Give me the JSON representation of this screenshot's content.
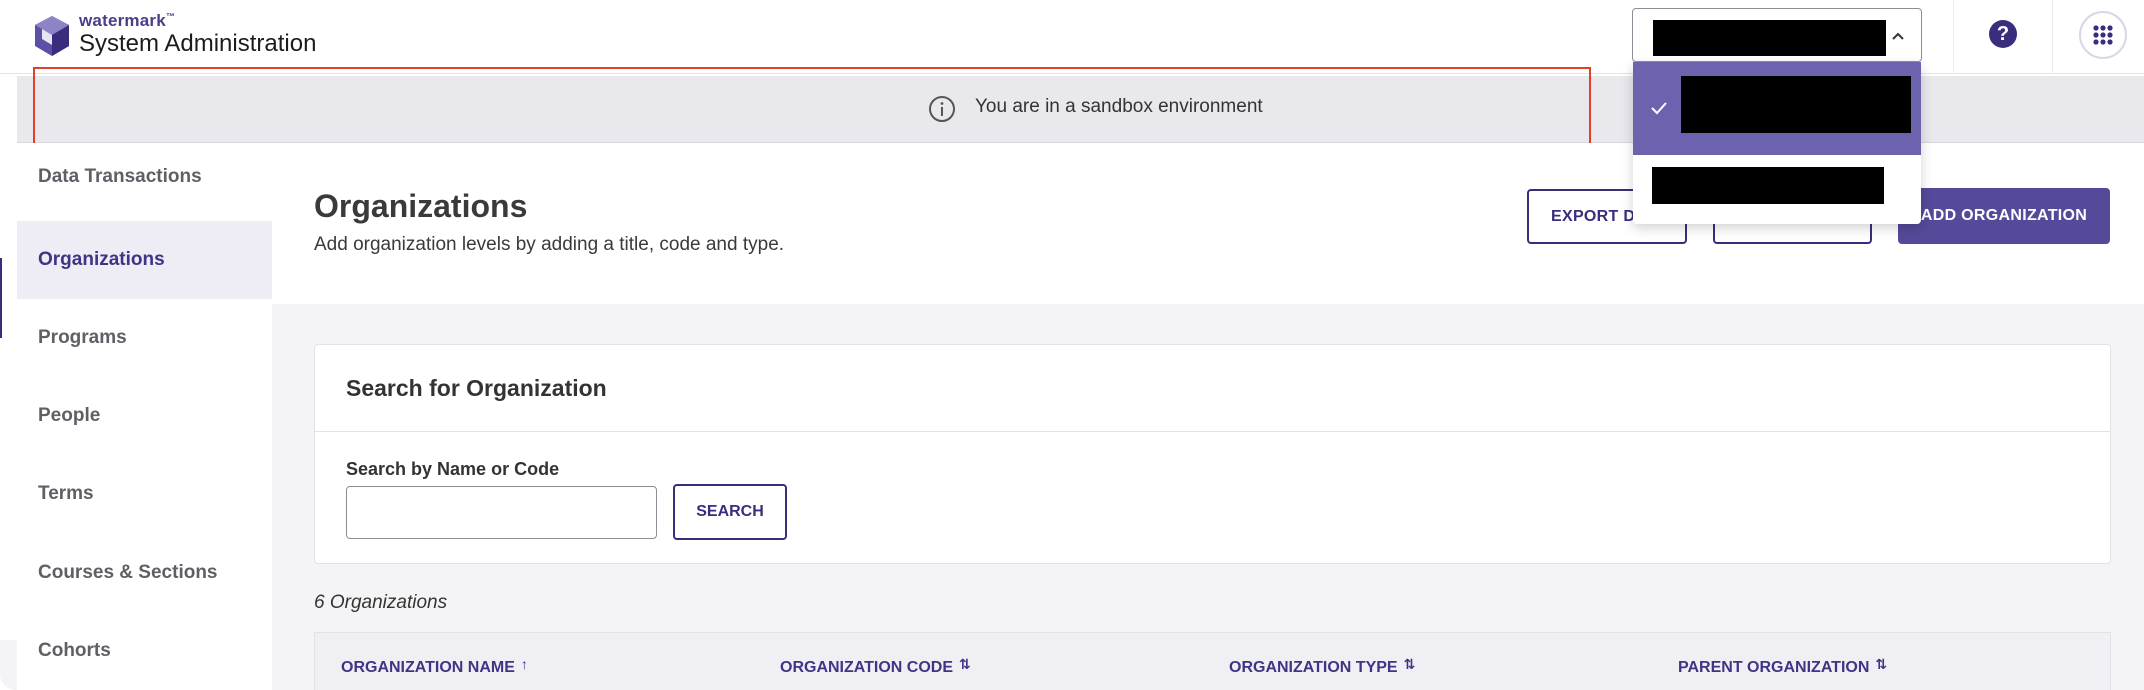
{
  "header": {
    "brand_small": "watermark",
    "brand_tm": "™",
    "app_title": "System Administration",
    "help_label": "?",
    "colors": {
      "brand": "#3a2d7e",
      "brand_light": "#544a9a",
      "highlight": "#e3402c"
    },
    "icons": {
      "logo": "watermark-logo-icon",
      "help": "help-icon",
      "apps": "apps-grid-icon",
      "select_chevron": "chevron-up-icon"
    }
  },
  "banner": {
    "text": "You are in a sandbox environment",
    "icon": "info-icon"
  },
  "sidebar": {
    "items": [
      {
        "label": "Data Transactions",
        "active": false
      },
      {
        "label": "Organizations",
        "active": true
      },
      {
        "label": "Programs",
        "active": false
      },
      {
        "label": "People",
        "active": false
      },
      {
        "label": "Terms",
        "active": false
      },
      {
        "label": "Courses & Sections",
        "active": false
      },
      {
        "label": "Cohorts",
        "active": false
      }
    ]
  },
  "page": {
    "title": "Organizations",
    "subtitle": "Add organization levels by adding a title, code and type.",
    "buttons": {
      "export_label": "EXPORT DATA",
      "second_label": "",
      "add_label": "ADD ORGANIZATION"
    }
  },
  "search_card": {
    "title": "Search for Organization",
    "field_label": "Search by Name or Code",
    "input_value": "",
    "search_label": "SEARCH"
  },
  "results": {
    "count_text": "6 Organizations",
    "columns": [
      {
        "label": "ORGANIZATION NAME",
        "sort_icon": "↑"
      },
      {
        "label": "ORGANIZATION CODE",
        "sort_icon": "⇅"
      },
      {
        "label": "ORGANIZATION TYPE",
        "sort_icon": "⇅"
      },
      {
        "label": "PARENT ORGANIZATION",
        "sort_icon": "⇅"
      }
    ]
  },
  "environment_dropdown": {
    "selected_value": "[redacted]",
    "options": [
      {
        "label": "[redacted]",
        "selected": true
      },
      {
        "label": "[redacted]",
        "selected": false
      }
    ],
    "icons": {
      "check": "check-icon"
    }
  }
}
